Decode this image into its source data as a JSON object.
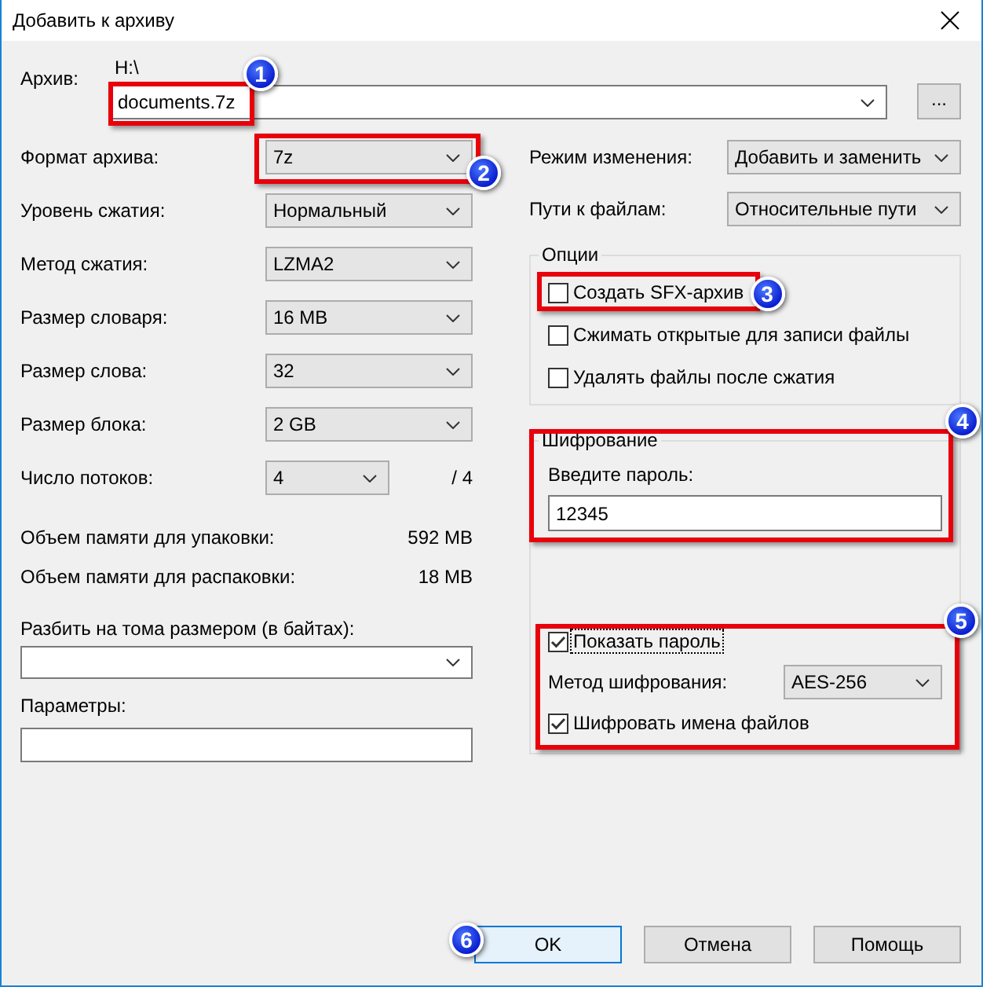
{
  "window": {
    "title": "Добавить к архиву"
  },
  "archive": {
    "label": "Архив:",
    "path": "H:\\",
    "value": "documents.7z",
    "callout": {
      "number": "1",
      "framed": true
    },
    "browse_button": "..."
  },
  "left_fields": [
    {
      "label": "Формат архива:",
      "value": "7z",
      "callout": {
        "number": "2",
        "framed": true
      }
    },
    {
      "label": "Уровень сжатия:",
      "value": "Нормальный"
    },
    {
      "label": "Метод сжатия:",
      "value": "LZMA2"
    },
    {
      "label": "Размер словаря:",
      "value": "16 MB"
    },
    {
      "label": "Размер слова:",
      "value": "32"
    },
    {
      "label": "Размер блока:",
      "value": "2 GB"
    },
    {
      "label": "Число потоков:",
      "value": "4",
      "suffix": "/ 4"
    }
  ],
  "memory": [
    {
      "label": "Объем памяти для упаковки:",
      "value": "592 MB"
    },
    {
      "label": "Объем памяти для распаковки:",
      "value": "18 MB"
    }
  ],
  "split_volumes": {
    "label": "Разбить на тома размером (в байтах):"
  },
  "parameters": {
    "label": "Параметры:"
  },
  "right_fields": [
    {
      "label": "Режим изменения:",
      "value": "Добавить и заменить"
    },
    {
      "label": "Пути к файлам:",
      "value": "Относительные пути"
    }
  ],
  "options": {
    "title": "Опции",
    "items": [
      {
        "label": "Создать SFX-архив",
        "checked": false,
        "callout": {
          "number": "3",
          "framed": true
        }
      },
      {
        "label": "Сжимать открытые для записи файлы",
        "checked": false
      },
      {
        "label": "Удалять файлы после сжатия",
        "checked": false
      }
    ]
  },
  "encryption": {
    "title": "Шифрование",
    "password_label": "Введите пароль:",
    "password": "12345",
    "callout": {
      "number": "4",
      "framed": true
    },
    "settings_callout": {
      "number": "5",
      "framed": true
    },
    "settings": [
      {
        "kind": "checkbox",
        "label": "Показать пароль",
        "checked": true,
        "focused": true
      },
      {
        "kind": "dropdown",
        "label": "Метод шифрования:",
        "value": "AES-256"
      },
      {
        "kind": "checkbox",
        "label": "Шифровать имена файлов",
        "checked": true,
        "focused": false
      }
    ]
  },
  "buttons": [
    {
      "label": "OK",
      "default": true,
      "callout": {
        "number": "6"
      }
    },
    {
      "label": "Отмена",
      "default": false
    },
    {
      "label": "Помощь",
      "default": false
    }
  ]
}
